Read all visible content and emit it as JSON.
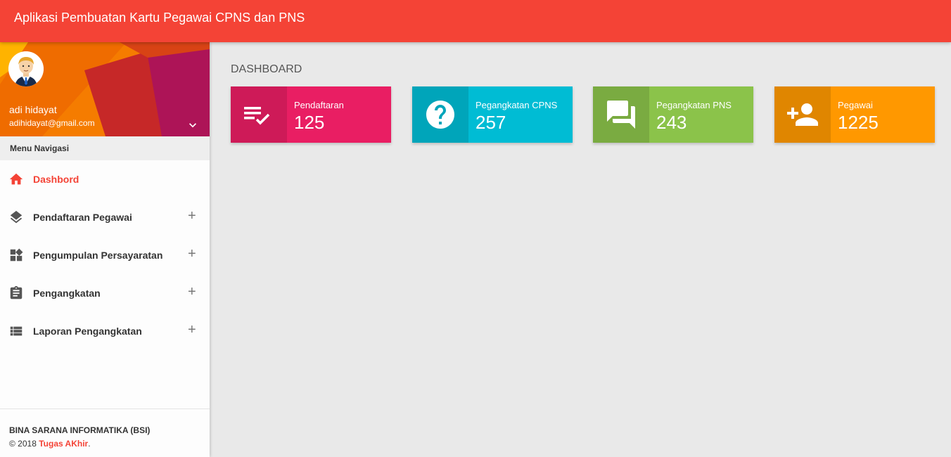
{
  "app": {
    "title": "Aplikasi Pembuatan Kartu Pegawai CPNS dan PNS"
  },
  "user": {
    "name": "adi hidayat",
    "email": "adihidayat@gmail.com"
  },
  "sidebar": {
    "header": "Menu Navigasi",
    "items": [
      {
        "label": "Dashbord",
        "icon": "home-icon",
        "active": true
      },
      {
        "label": "Pendaftaran Pegawai",
        "icon": "layers-icon",
        "expand": "+"
      },
      {
        "label": "Pengumpulan Persayaratan",
        "icon": "widgets-icon",
        "expand": "+"
      },
      {
        "label": "Pengangkatan",
        "icon": "clipboard-icon",
        "expand": "+"
      },
      {
        "label": "Laporan Pengangkatan",
        "icon": "list-icon",
        "expand": "+"
      }
    ]
  },
  "footer": {
    "org": "BINA SARANA INFORMATIKA (BSI)",
    "copy_prefix": "© 2018 ",
    "link": "Tugas AKhir",
    "copy_suffix": "."
  },
  "main": {
    "title": "DASHBOARD",
    "cards": [
      {
        "label": "Pendaftaran",
        "value": "125",
        "icon": "playlist-check-icon",
        "color": "#e91e63",
        "dark": "#ce1a58"
      },
      {
        "label": "Pegangkatan CPNS",
        "value": "257",
        "icon": "help-icon",
        "color": "#00bcd4",
        "dark": "#00a5ba"
      },
      {
        "label": "Pegangkatan PNS",
        "value": "243",
        "icon": "forum-icon",
        "color": "#8bc34a",
        "dark": "#7aab41"
      },
      {
        "label": "Pegawai",
        "value": "1225",
        "icon": "person-add-icon",
        "color": "#ff9800",
        "dark": "#e08600"
      }
    ]
  },
  "colors": {
    "accent": "#f44336"
  }
}
